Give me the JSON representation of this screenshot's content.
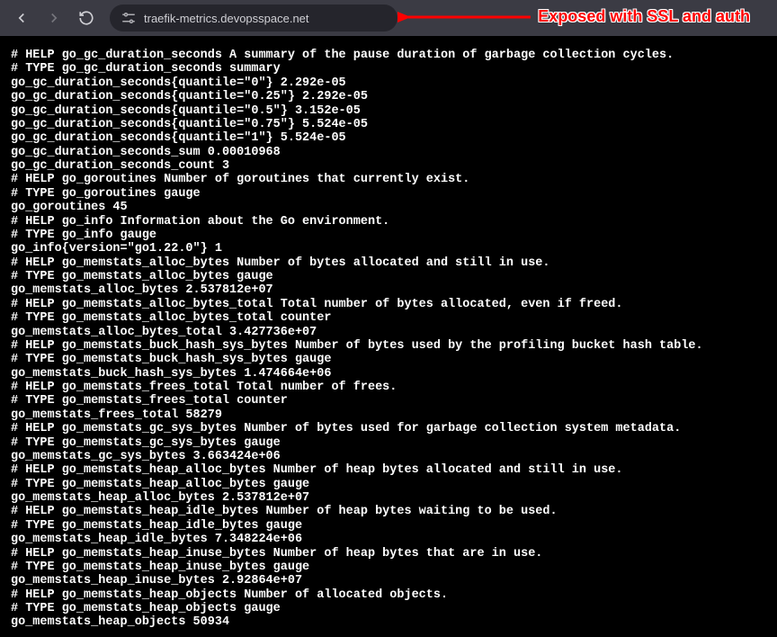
{
  "browser": {
    "url": "traefik-metrics.devopsspace.net"
  },
  "annotation": {
    "text": "Exposed with SSL and auth"
  },
  "metrics_text": "# HELP go_gc_duration_seconds A summary of the pause duration of garbage collection cycles.\n# TYPE go_gc_duration_seconds summary\ngo_gc_duration_seconds{quantile=\"0\"} 2.292e-05\ngo_gc_duration_seconds{quantile=\"0.25\"} 2.292e-05\ngo_gc_duration_seconds{quantile=\"0.5\"} 3.152e-05\ngo_gc_duration_seconds{quantile=\"0.75\"} 5.524e-05\ngo_gc_duration_seconds{quantile=\"1\"} 5.524e-05\ngo_gc_duration_seconds_sum 0.00010968\ngo_gc_duration_seconds_count 3\n# HELP go_goroutines Number of goroutines that currently exist.\n# TYPE go_goroutines gauge\ngo_goroutines 45\n# HELP go_info Information about the Go environment.\n# TYPE go_info gauge\ngo_info{version=\"go1.22.0\"} 1\n# HELP go_memstats_alloc_bytes Number of bytes allocated and still in use.\n# TYPE go_memstats_alloc_bytes gauge\ngo_memstats_alloc_bytes 2.537812e+07\n# HELP go_memstats_alloc_bytes_total Total number of bytes allocated, even if freed.\n# TYPE go_memstats_alloc_bytes_total counter\ngo_memstats_alloc_bytes_total 3.427736e+07\n# HELP go_memstats_buck_hash_sys_bytes Number of bytes used by the profiling bucket hash table.\n# TYPE go_memstats_buck_hash_sys_bytes gauge\ngo_memstats_buck_hash_sys_bytes 1.474664e+06\n# HELP go_memstats_frees_total Total number of frees.\n# TYPE go_memstats_frees_total counter\ngo_memstats_frees_total 58279\n# HELP go_memstats_gc_sys_bytes Number of bytes used for garbage collection system metadata.\n# TYPE go_memstats_gc_sys_bytes gauge\ngo_memstats_gc_sys_bytes 3.663424e+06\n# HELP go_memstats_heap_alloc_bytes Number of heap bytes allocated and still in use.\n# TYPE go_memstats_heap_alloc_bytes gauge\ngo_memstats_heap_alloc_bytes 2.537812e+07\n# HELP go_memstats_heap_idle_bytes Number of heap bytes waiting to be used.\n# TYPE go_memstats_heap_idle_bytes gauge\ngo_memstats_heap_idle_bytes 7.348224e+06\n# HELP go_memstats_heap_inuse_bytes Number of heap bytes that are in use.\n# TYPE go_memstats_heap_inuse_bytes gauge\ngo_memstats_heap_inuse_bytes 2.92864e+07\n# HELP go_memstats_heap_objects Number of allocated objects.\n# TYPE go_memstats_heap_objects gauge\ngo_memstats_heap_objects 50934"
}
